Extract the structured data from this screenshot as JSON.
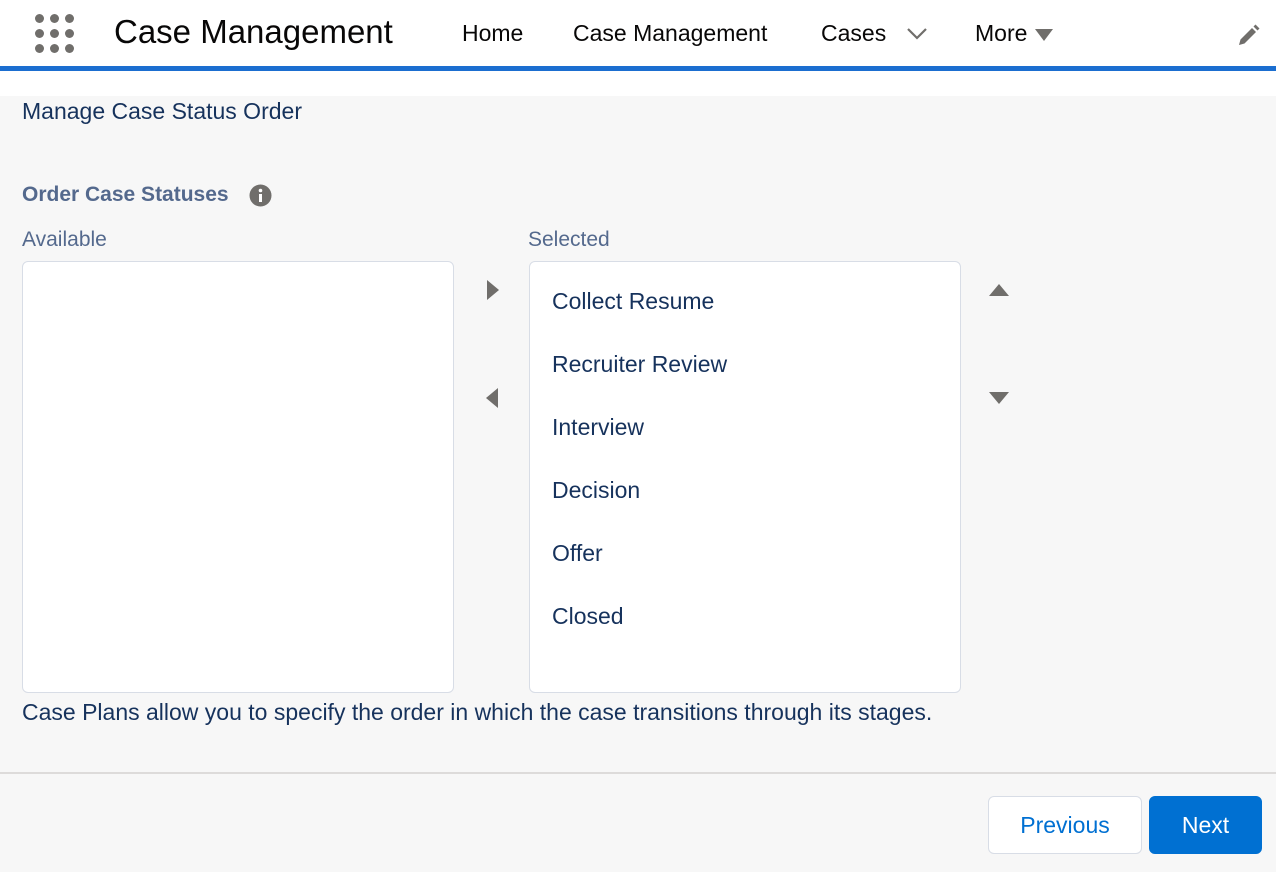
{
  "header": {
    "app_name": "Case Management",
    "nav": {
      "home": "Home",
      "case_management": "Case Management",
      "cases": "Cases",
      "more": "More"
    }
  },
  "page": {
    "title": "Manage Case Status Order",
    "section_label": "Order Case Statuses",
    "available_label": "Available",
    "selected_label": "Selected",
    "available_items": [],
    "selected_items": [
      "Collect Resume",
      "Recruiter Review",
      "Interview",
      "Decision",
      "Offer",
      "Closed"
    ],
    "help_text": "Case Plans allow you to specify the order in which the case transitions through its stages."
  },
  "footer": {
    "previous_label": "Previous",
    "next_label": "Next"
  },
  "icons": {
    "launcher": "app-launcher-icon",
    "cases_menu": "chevron-down-icon",
    "more_menu": "caret-down-icon",
    "edit": "pencil-icon",
    "info": "info-icon",
    "move_right": "arrow-right-icon",
    "move_left": "arrow-left-icon",
    "move_up": "arrow-up-icon",
    "move_down": "arrow-down-icon"
  },
  "colors": {
    "brand": "#0070d2",
    "header_accent": "#1b6ed0",
    "text": "#16325c",
    "muted_text": "#54698d"
  }
}
